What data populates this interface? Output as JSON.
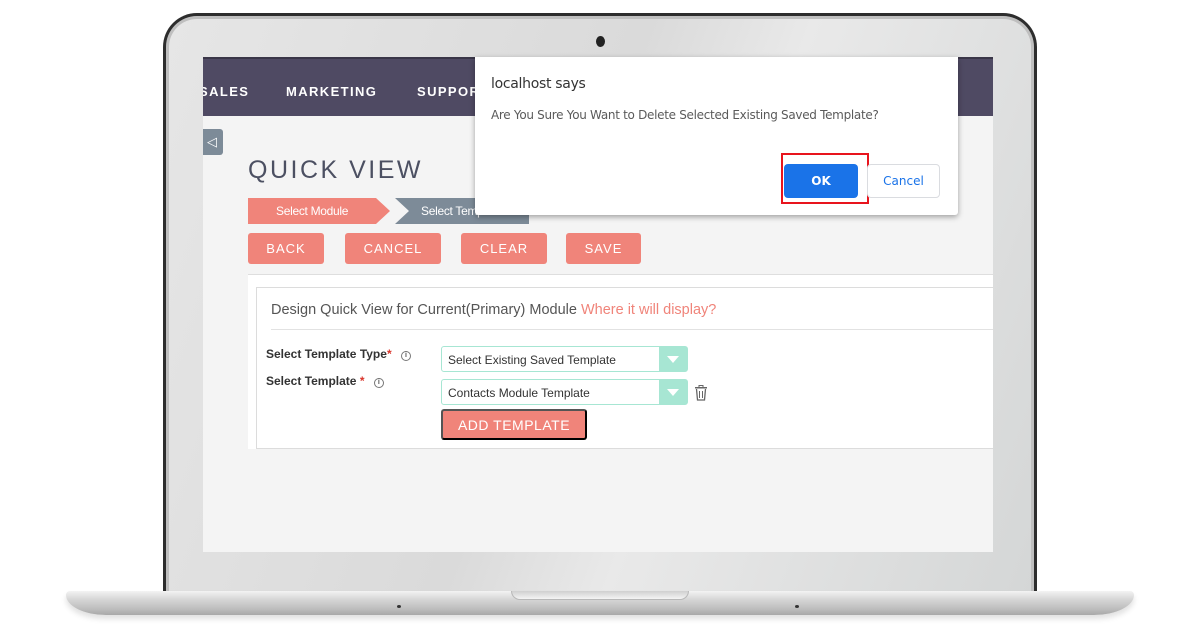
{
  "nav": {
    "items": [
      {
        "label": "SALES"
      },
      {
        "label": "MARKETING"
      },
      {
        "label": "SUPPORT"
      }
    ]
  },
  "page": {
    "title": "QUICK VIEW",
    "sidebar_toggle_icon": "collapse-left-icon"
  },
  "wizard": {
    "steps": [
      {
        "label": "Select Module",
        "state": "active"
      },
      {
        "label": "Select Template",
        "state": "inactive"
      }
    ]
  },
  "toolbar": {
    "back_label": "BACK",
    "cancel_label": "CANCEL",
    "clear_label": "CLEAR",
    "save_label": "SAVE"
  },
  "panel": {
    "heading": "Design Quick View for Current(Primary) Module",
    "help_link": "Where it will display?",
    "fields": [
      {
        "label": "Select Template Type",
        "required_mark": "*",
        "info_icon": "i",
        "value": "Select Existing Saved Template"
      },
      {
        "label": "Select Template ",
        "required_mark": "*",
        "info_icon": "i",
        "value": "Contacts Module Template"
      }
    ],
    "delete_icon": "trash-icon",
    "add_template_label": "ADD TEMPLATE"
  },
  "dialog": {
    "title": "localhost says",
    "message": "Are You Sure You Want to Delete Selected Existing Saved Template?",
    "ok_label": "OK",
    "cancel_label": "Cancel"
  },
  "colors": {
    "nav_bg": "#4f4a63",
    "accent": "#f0847a",
    "step_inactive": "#7d8b98",
    "select_accent": "#a7e6d3",
    "ok_blue": "#1a73e8",
    "highlight_red": "#e8141d"
  }
}
